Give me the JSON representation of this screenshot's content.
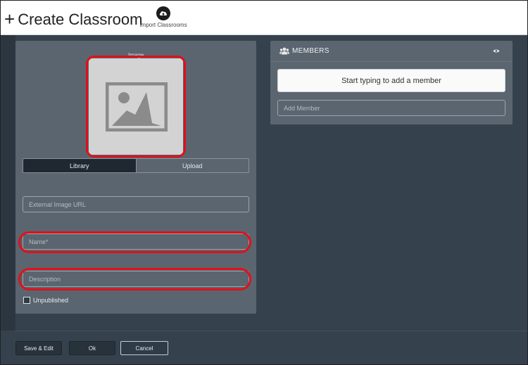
{
  "header": {
    "plus_icon": "+",
    "title": "Create Classroom",
    "import_icon": "cloud-upload-icon",
    "import_label": "Import Classrooms"
  },
  "image_panel": {
    "label": "Image",
    "placeholder_icon": "image-placeholder-icon",
    "tabs": [
      {
        "label": "Library",
        "active": true
      },
      {
        "label": "Upload",
        "active": false
      }
    ],
    "external_url_placeholder": "External Image URL",
    "name_placeholder": "Name*",
    "description_placeholder": "Description",
    "unpublished_label": "Unpublished",
    "unpublished_checked": false
  },
  "members": {
    "icon": "users-icon",
    "title": "MEMBERS",
    "toggle_icon": "eye-icon",
    "add_button_label": "Start typing to add a member",
    "add_member_placeholder": "Add Member"
  },
  "footer": {
    "save_edit_label": "Save & Edit",
    "ok_label": "Ok",
    "cancel_label": "Cancel"
  },
  "colors": {
    "background": "#35414c",
    "panel": "#5a656f",
    "highlight_ring": "#e0101a",
    "active_tab": "#1f2830"
  }
}
